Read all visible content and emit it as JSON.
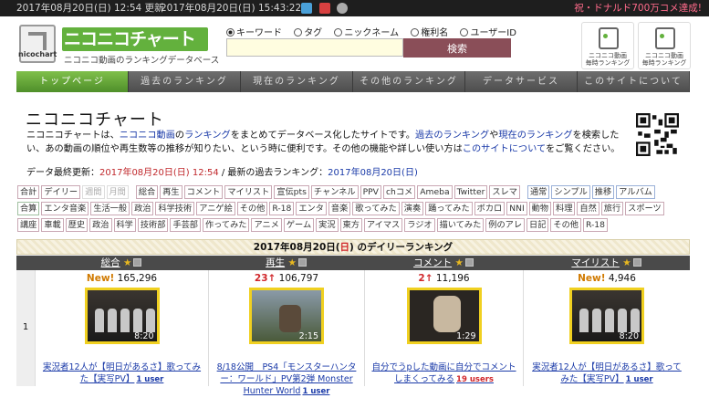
{
  "topbar": {
    "updated_left": "2017年08月20日(日) 12:54 更新",
    "updated_right": "2017年08月20日(日) 15:43:22",
    "celebrate": "祝・ドナルド700万コメ達成!"
  },
  "logo": {
    "small": "nicochart",
    "main": "ニコニコチャート",
    "sub": "ニコニコ動画のランキングデータベース"
  },
  "search": {
    "options": [
      "キーワード",
      "タグ",
      "ニックネーム",
      "権利名",
      "ユーザーID"
    ],
    "selected": "キーワード",
    "input_value": "",
    "button": "検索"
  },
  "header_links": [
    {
      "label": "ニコニコ動画\n毎時ランキング"
    },
    {
      "label": "ニコニコ動画\n毎時ランキング"
    }
  ],
  "nav": {
    "tabs": [
      "トップページ",
      "過去のランキング",
      "現在のランキング",
      "その他のランキング",
      "データサービス",
      "このサイトについて"
    ],
    "active": "トップページ"
  },
  "page": {
    "title": "ニコニコチャート",
    "desc_parts": [
      "ニコニコチャートは、",
      "ニコニコ動画",
      "の",
      "ランキング",
      "をまとめてデータベース化したサイトです。",
      "過去のランキング",
      "や",
      "現在のランキング",
      "を検索したい、あの動画の順位や再生数等の推移が知りたい、という時に便利です。その他の機能や詳しい使い方は",
      "このサイトについて",
      "をご覧ください。"
    ],
    "updated_label": "データ最終更新：",
    "updated_date": "2017年08月20日(日) 12:54",
    "past_label": " / 最新の過去ランキング：",
    "past_date": "2017年08月20日(日)"
  },
  "tags_row1": [
    {
      "t": "合計"
    },
    {
      "t": "デイリー"
    },
    {
      "t": "週間",
      "dim": true
    },
    {
      "t": "月間",
      "dim": true
    },
    {
      "sep": true
    },
    {
      "t": "総合"
    },
    {
      "t": "再生"
    },
    {
      "t": "コメント"
    },
    {
      "t": "マイリスト"
    },
    {
      "t": "宣伝pts"
    },
    {
      "t": "チャンネル"
    },
    {
      "t": "PPV"
    },
    {
      "t": "chコメ"
    },
    {
      "t": "Ameba"
    },
    {
      "t": "Twitter"
    },
    {
      "t": "スレマ"
    },
    {
      "sep": true
    },
    {
      "t": "通常",
      "c": "b"
    },
    {
      "t": "シンプル",
      "c": "b"
    },
    {
      "t": "推移",
      "c": "b"
    },
    {
      "t": "アルバム",
      "c": "b"
    }
  ],
  "tags_row2": [
    "合算",
    "エンタ音楽",
    "生活一般",
    "政治",
    "科学技術",
    "アニゲ絵",
    "その他",
    "R-18",
    "エンタ",
    "音楽",
    "歌ってみた",
    "演奏",
    "踊ってみた",
    "ボカロ",
    "NNI",
    "動物",
    "料理",
    "自然",
    "旅行",
    "スポーツ"
  ],
  "tags_row3": [
    "講座",
    "車載",
    "歴史",
    "政治",
    "科学",
    "技術部",
    "手芸部",
    "作ってみた",
    "アニメ",
    "ゲーム",
    "実況",
    "東方",
    "アイマス",
    "ラジオ",
    "描いてみた",
    "例のアレ",
    "日記",
    "その他",
    "R-18"
  ],
  "ranking": {
    "title_prefix": "2017年08月20日(",
    "title_day": "日",
    "title_suffix": ") のデイリーランキング",
    "columns": [
      "総合",
      "再生",
      "コメント",
      "マイリスト"
    ],
    "rank": "1",
    "cells": [
      {
        "change": "New!",
        "count": "165,296",
        "duration": "8:20",
        "title": "実況者12人が【明日があるさ】歌ってみた【実写PV】",
        "users": "1 user",
        "hot": false
      },
      {
        "change": "23↑",
        "count": "106,797",
        "duration": "2:15",
        "title": "8/18公開　PS4「モンスターハンター：ワールド」PV第2弾 Monster Hunter World",
        "users": "1 user",
        "hot": false
      },
      {
        "change": "2↑",
        "count": "11,196",
        "duration": "1:29",
        "title": "自分でうpした動画に自分でコメントしまくってみる",
        "users": "19 users",
        "hot": true
      },
      {
        "change": "New!",
        "count": "4,946",
        "duration": "8:20",
        "title": "実況者12人が【明日があるさ】歌ってみた【実写PV】",
        "users": "1 user",
        "hot": false
      }
    ]
  },
  "colors": {
    "accent_green": "#63b13d",
    "search_button": "#8a4e58",
    "rank_up": "#d0262a",
    "link": "#1a3aa8"
  }
}
